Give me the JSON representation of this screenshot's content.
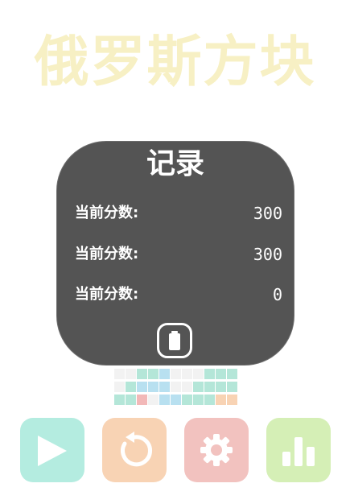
{
  "game": {
    "title": "俄罗斯方块"
  },
  "record": {
    "title": "记录",
    "rows": [
      {
        "label": "当前分数:",
        "value": "300"
      },
      {
        "label": "当前分数:",
        "value": "300"
      },
      {
        "label": "当前分数:",
        "value": "0"
      }
    ],
    "close_icon": "battery-icon"
  },
  "buttons": {
    "play_icon": "play-icon",
    "restart_icon": "restart-icon",
    "settings_icon": "gear-icon",
    "rank_icon": "bar-chart-icon"
  },
  "colors": {
    "title": "#f7f0c4",
    "panel": "#545454",
    "play": "#b4ece0",
    "restart": "#f8d3b4",
    "settings": "#f2c2bf",
    "rank": "#d5efb6"
  },
  "mini_board": {
    "rows": [
      "eeggbeeeggg",
      "egbbbeegggg",
      "ggrebbgggoo"
    ]
  }
}
